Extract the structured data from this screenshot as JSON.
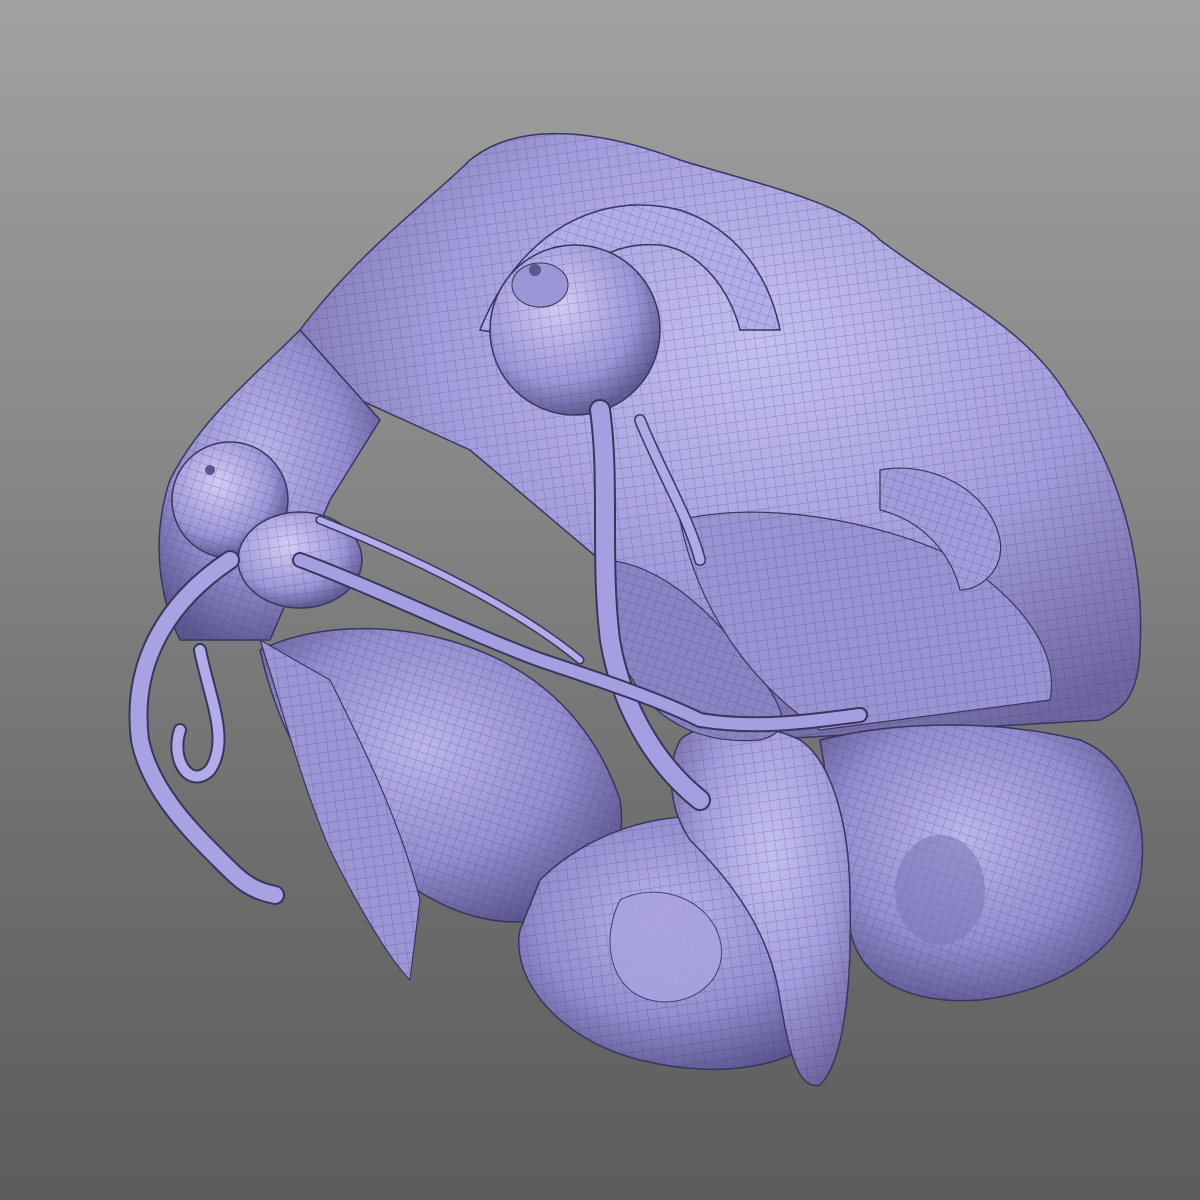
{
  "viewport": {
    "background_top": "#a1a1a1",
    "background_bottom": "#5c5c5c"
  },
  "model": {
    "shading": "wireframe-on-shaded",
    "surface_color": "#aaa3e3",
    "surface_dark": "#6f68a6",
    "surface_shadow": "#4a4478",
    "wire_color": "#3f3a66",
    "parts": [
      "head-surface",
      "left-eye",
      "right-eye",
      "optic-nerves",
      "brain-lobe-left",
      "brain-lobe-center",
      "brain-lobe-right",
      "facial-flap"
    ]
  }
}
